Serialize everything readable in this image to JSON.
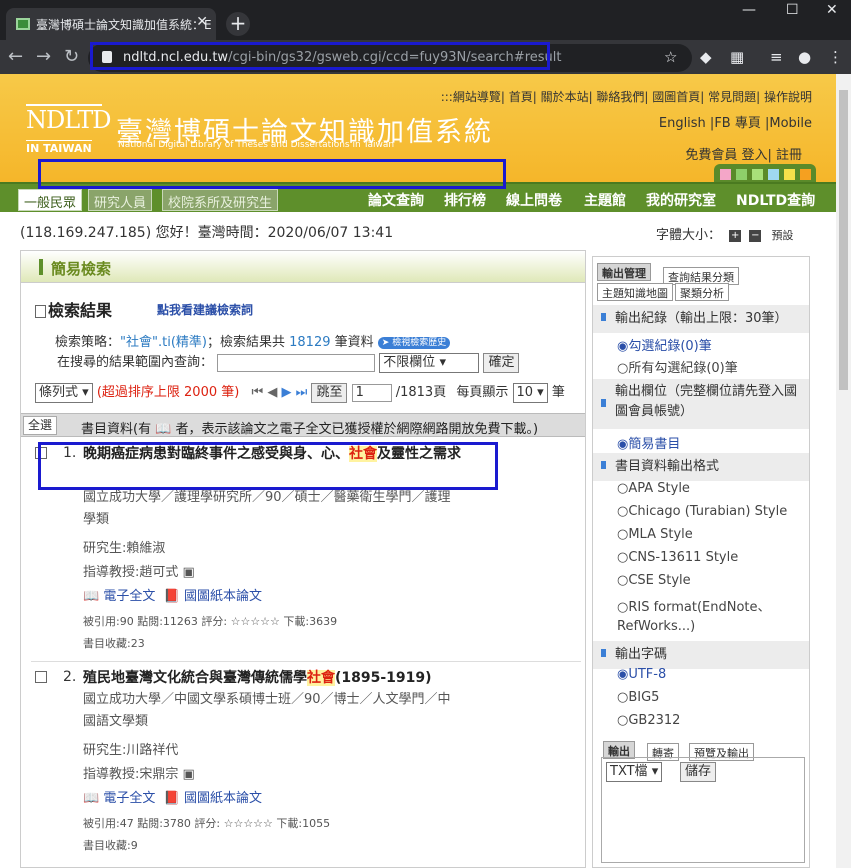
{
  "browser": {
    "tab_title": "臺灣博碩士論文知識加值系統：E",
    "url_host": "ndltd.ncl.edu.tw",
    "url_path": "/cgi-bin/gs32/gsweb.cgi/ccd=fuy93N/search#result"
  },
  "site": {
    "logo": "NDLTD",
    "logo_sub": "IN TAIWAN",
    "title": "臺灣博碩士論文知識加值系統",
    "subtitle": "National Digital Library of Theses and Dissertations in Taiwan",
    "top_links": ":::網站導覽| 首頁| 關於本站| 聯絡我們| 國圖首頁| 常見問題| 操作說明",
    "lang_links": "English |FB 專頁 |Mobile",
    "member_links": "免費會員 登入| 註冊",
    "colors": [
      "#f4a6c8",
      "#8ecf6a",
      "#a8e07a",
      "#9fd8f0",
      "#f7e04a",
      "#f5a020"
    ]
  },
  "nav": {
    "roles": [
      "一般民眾",
      "研究人員",
      "校院系所及研究生"
    ],
    "items": [
      "論文查詢",
      "排行榜",
      "線上問卷",
      "主題館",
      "我的研究室",
      "NDLTD查詢"
    ]
  },
  "status": {
    "ip_line": "(118.169.247.185) 您好！臺灣時間：2020/06/07 13:41",
    "font_label": "字體大小：",
    "font_default": "預設"
  },
  "search": {
    "panel_title": "簡易檢索",
    "result_title": "檢索結果",
    "suggest_link": "點我看建議檢索詞",
    "strategy_prefix": "檢索策略：",
    "strategy_query": "\"社會\".ti(精準)",
    "strategy_mid": "；檢索結果共",
    "count": "18129",
    "strategy_suffix": "筆資料",
    "history_btn": "檢視檢索歷史",
    "within_label": "在搜尋的結果範圍內查詢：",
    "field_select": "不限欄位",
    "confirm": "確定",
    "sort_select": "條列式",
    "sort_warning": "(超過排序上限 2000 筆)",
    "goto_label": "跳至",
    "page_value": "1",
    "page_total": "/1813頁",
    "per_page_label": "每頁顯示",
    "per_page_value": "10",
    "per_page_unit": "筆",
    "select_all": "全選",
    "table_header": "書目資料(有 📖 者，表示該論文之電子全文已獲授權於網際網路開放免費下載。)"
  },
  "records": [
    {
      "num": "1.",
      "title_a": "晚期癌症病患對臨終事件之感受與身、心、",
      "title_hi": "社會",
      "title_b": "及靈性之需求",
      "meta": "國立成功大學／護理學研究所／90／碩士／醫藥衛生學門／護理學類",
      "student": "研究生:賴維淑",
      "advisor": "指導教授:趙可式",
      "fulltext": "電子全文",
      "paper": "國圖紙本論文",
      "stats": "被引用:90 點閱:11263 評分: ☆☆☆☆☆ 下載:3639",
      "bookmarks": "書目收藏:23"
    },
    {
      "num": "2.",
      "title_a": "殖民地臺灣文化統合與臺灣傳統儒學",
      "title_hi": "社會",
      "title_b": "(1895-1919)",
      "meta": "國立成功大學／中國文學系碩博士班／90／博士／人文學門／中國語文學類",
      "student": "研究生:川路祥代",
      "advisor": "指導教授:宋鼎宗",
      "fulltext": "電子全文",
      "paper": "國圖紙本論文",
      "stats": "被引用:47 點閱:3780 評分: ☆☆☆☆☆ 下載:1055",
      "bookmarks": "書目收藏:9"
    }
  ],
  "side": {
    "tabs": [
      "輸出管理",
      "查詢結果分類",
      "主題知識地圖",
      "聚類分析"
    ],
    "out_records": "輸出紀錄（輸出上限：30筆）",
    "opt_checked": "勾選紀錄(0)筆",
    "opt_all": "所有勾選紀錄(0)筆",
    "out_fields": "輸出欄位（完整欄位請先登入國圖會員帳號）",
    "opt_simple": "簡易書目",
    "out_format": "書目資料輸出格式",
    "formats": [
      "APA Style",
      "Chicago (Turabian) Style",
      "MLA Style",
      "CNS-13611 Style",
      "CSE Style",
      "RIS format(EndNote、",
      "RefWorks...)"
    ],
    "out_charset": "輸出字碼",
    "charsets": [
      "UTF-8",
      "BIG5",
      "GB2312"
    ],
    "out_tabs": [
      "輸出",
      "轉寄",
      "預覽及輸出"
    ],
    "file_select": "TXT檔",
    "save": "儲存"
  }
}
